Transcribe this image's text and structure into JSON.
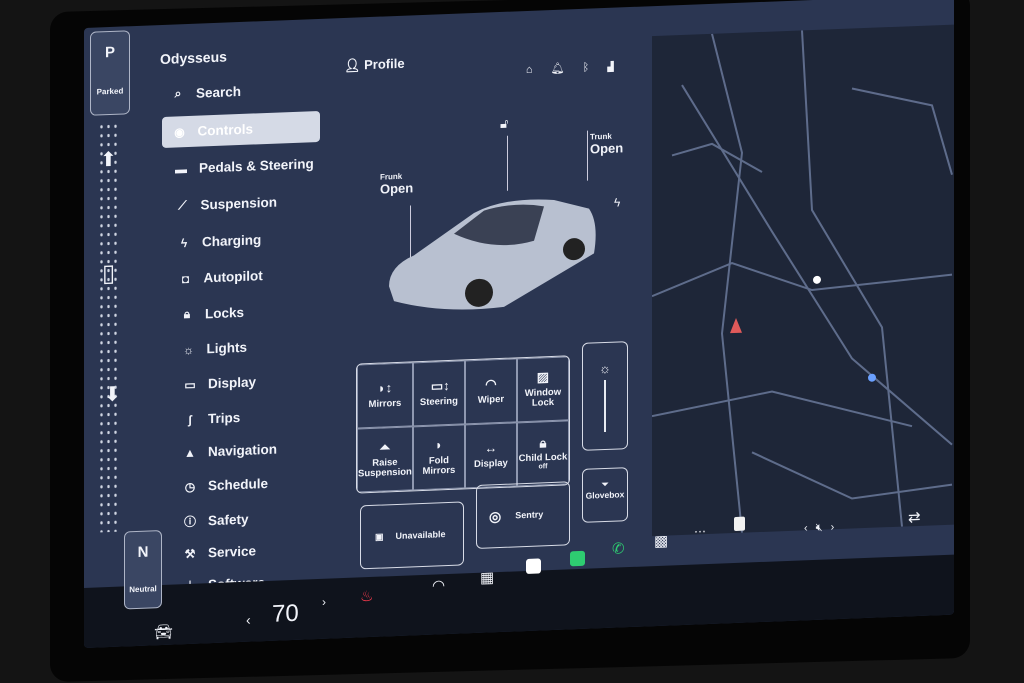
{
  "gear": {
    "top_letter": "P",
    "top_label": "Parked",
    "bottom_letter": "N",
    "bottom_label": "Neutral"
  },
  "sidebar": {
    "vehicle_name": "Odysseus",
    "items": [
      {
        "label": "Search",
        "icon": "search-icon",
        "glyph": "⌕"
      },
      {
        "label": "Controls",
        "icon": "toggle-icon",
        "glyph": "◉"
      },
      {
        "label": "Pedals & Steering",
        "icon": "car-icon",
        "glyph": "▬"
      },
      {
        "label": "Suspension",
        "icon": "suspension-icon",
        "glyph": "⟋"
      },
      {
        "label": "Charging",
        "icon": "lightning-icon",
        "glyph": "ϟ"
      },
      {
        "label": "Autopilot",
        "icon": "autopilot-icon",
        "glyph": "◘"
      },
      {
        "label": "Locks",
        "icon": "lock-icon",
        "glyph": "🔒︎"
      },
      {
        "label": "Lights",
        "icon": "sun-icon",
        "glyph": "☼"
      },
      {
        "label": "Display",
        "icon": "display-icon",
        "glyph": "▭"
      },
      {
        "label": "Trips",
        "icon": "trips-icon",
        "glyph": "ʃ"
      },
      {
        "label": "Navigation",
        "icon": "navigation-icon",
        "glyph": "▲"
      },
      {
        "label": "Schedule",
        "icon": "clock-icon",
        "glyph": "◷"
      },
      {
        "label": "Safety",
        "icon": "safety-icon",
        "glyph": "ⓘ"
      },
      {
        "label": "Service",
        "icon": "wrench-icon",
        "glyph": "⚒"
      },
      {
        "label": "Software",
        "icon": "download-icon",
        "glyph": "⤓"
      }
    ],
    "active": "Controls"
  },
  "header": {
    "profile_label": "Profile"
  },
  "car": {
    "frunk_label": "Frunk",
    "frunk_state": "Open",
    "trunk_label": "Trunk",
    "trunk_state": "Open"
  },
  "controls": {
    "grid": [
      {
        "label": "Mirrors",
        "glyph": "◗↕"
      },
      {
        "label": "Steering",
        "glyph": "▭↕"
      },
      {
        "label": "Wiper",
        "glyph": "◠"
      },
      {
        "label": "Window Lock",
        "glyph": "▨"
      },
      {
        "label": "Raise Suspension",
        "glyph": "⏶"
      },
      {
        "label": "Fold Mirrors",
        "glyph": "◗"
      },
      {
        "label": "Display",
        "glyph": "↔"
      },
      {
        "label": "Child Lock",
        "sub": "off",
        "glyph": "🔒︎"
      }
    ],
    "unavailable": "Unavailable",
    "sentry": "Sentry",
    "glovebox": "Glovebox",
    "brightness_level": 1.0
  },
  "bottom": {
    "speed": "70",
    "accent_green": "#2ecc71",
    "seat_heat_color": "#ff3b4e"
  }
}
